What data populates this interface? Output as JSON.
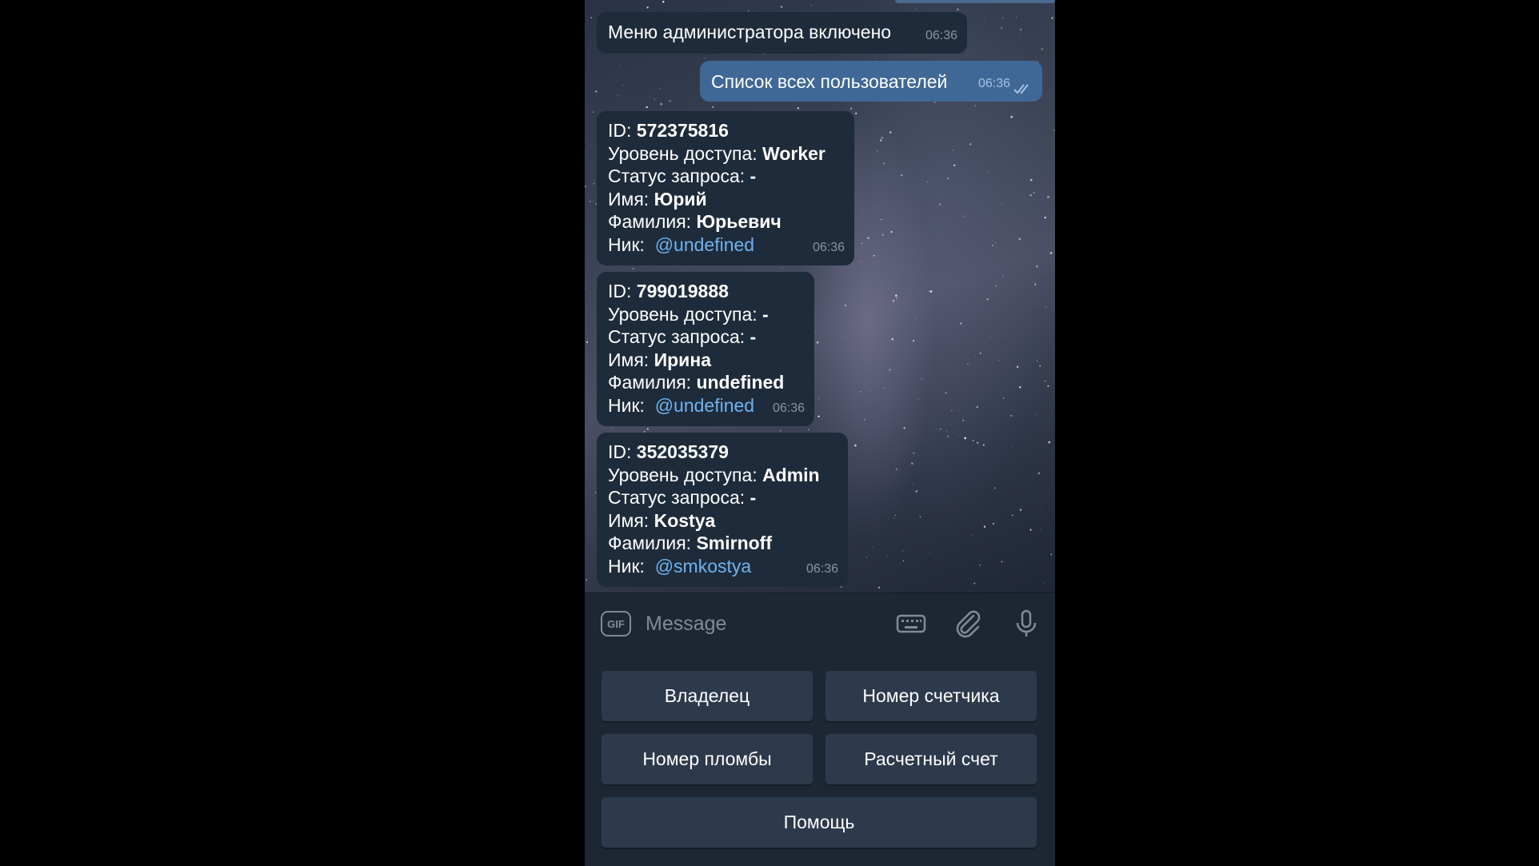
{
  "chat": {
    "messages": [
      {
        "text": "Меню администратора включено",
        "time": "06:36"
      },
      {
        "text": "Список всех пользователей",
        "time": "06:36"
      }
    ],
    "labels": {
      "id": "ID:",
      "access": "Уровень доступа:",
      "status": "Статус запроса:",
      "name": "Имя:",
      "surname": "Фамилия:",
      "nick": "Ник:"
    },
    "users": [
      {
        "id": "572375816",
        "access": "Worker",
        "status": "-",
        "name": "Юрий",
        "surname": "Юрьевич",
        "nick": "@undefined",
        "time": "06:36"
      },
      {
        "id": "799019888",
        "access": "-",
        "status": "-",
        "name": "Ирина",
        "surname": "undefined",
        "nick": "@undefined",
        "time": "06:36"
      },
      {
        "id": "352035379",
        "access": "Admin",
        "status": "-",
        "name": "Kostya",
        "surname": "Smirnoff",
        "nick": "@smkostya",
        "time": "06:36"
      }
    ]
  },
  "input": {
    "gif_label": "GIF",
    "placeholder": "Message",
    "icons": [
      "gif-icon",
      "keyboard-icon",
      "paperclip-icon",
      "microphone-icon"
    ]
  },
  "keyboard": {
    "buttons": [
      "Владелец",
      "Номер счетчика",
      "Номер пломбы",
      "Расчетный счет",
      "Помощь"
    ]
  },
  "colors": {
    "incoming_bubble": "#1e2b3a",
    "outgoing_bubble": "#3f6896",
    "link": "#6fb3f0",
    "panel": "#1d2733",
    "keyboard_button": "#2c3a4b"
  }
}
